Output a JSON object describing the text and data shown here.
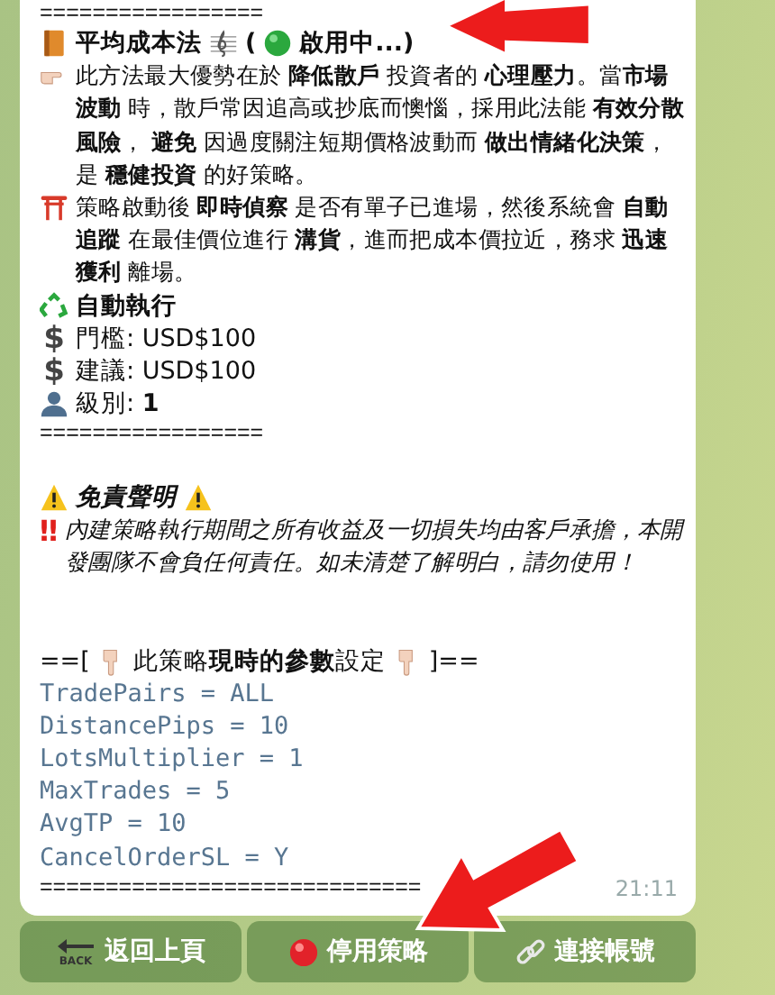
{
  "message": {
    "lines": [
      {
        "kind": "rule",
        "text": "================="
      },
      {
        "kind": "row",
        "segments": [
          {
            "kind": "book"
          },
          {
            "kind": "bold",
            "text": "平均成本法"
          },
          {
            "kind": "clef"
          },
          {
            "kind": "bold",
            "text": "("
          },
          {
            "kind": "status-dot"
          },
          {
            "kind": "bold",
            "text": "啟用中...)"
          }
        ]
      },
      {
        "kind": "para",
        "icon": {
          "kind": "hand-right"
        },
        "text": "此方法最大優勢在於 **降低散戶** 投資者的 **心理壓力**。當**市場波動** 時，散戶常因追高或抄底而懊惱，採用此法能 **有效分散風險**， **避免** 因過度關注短期價格波動而 **做出情緒化決策**，是 **穩健投資** 的好策略。"
      },
      {
        "kind": "para",
        "icon": {
          "kind": "torii"
        },
        "text": "策略啟動後 **即時偵察** 是否有單子已進場，然後系統會 **自動追蹤** 在最佳價位進行 **溝貨**，進而把成本價拉近，務求 **迅速獲利** 離場。"
      },
      {
        "kind": "row",
        "segments": [
          {
            "kind": "recycle"
          },
          {
            "kind": "bold",
            "text": "自動執行"
          }
        ]
      },
      {
        "kind": "row",
        "segments": [
          {
            "kind": "dollar",
            "text": "$"
          },
          {
            "kind": "plain",
            "text": "門檻: USD$100"
          }
        ]
      },
      {
        "kind": "row",
        "segments": [
          {
            "kind": "dollar",
            "text": "$"
          },
          {
            "kind": "plain",
            "text": "建議: USD$100"
          }
        ]
      },
      {
        "kind": "row",
        "segments": [
          {
            "kind": "person"
          },
          {
            "kind": "plain",
            "text": "級別: **1**"
          }
        ]
      },
      {
        "kind": "rule",
        "text": "================="
      },
      {
        "kind": "blank"
      },
      {
        "kind": "row",
        "segments": [
          {
            "kind": "warning"
          },
          {
            "kind": "bold-italic",
            "text": "免責聲明"
          },
          {
            "kind": "warning"
          }
        ]
      },
      {
        "kind": "note",
        "icon": {
          "kind": "exclaim",
          "text": "‼"
        },
        "text": "內建策略執行期間之所有收益及一切損失均由客戶承擔，本開發團隊不會負任何責任。如未清楚了解明白，請勿使用！"
      },
      {
        "kind": "blank"
      },
      {
        "kind": "blank"
      },
      {
        "kind": "row",
        "segments": [
          {
            "kind": "plain",
            "text": "==["
          },
          {
            "kind": "hand-down"
          },
          {
            "kind": "plain",
            "text": "此策略**現時的參數**設定"
          },
          {
            "kind": "hand-down"
          },
          {
            "kind": "plain",
            "text": "]=="
          }
        ]
      },
      {
        "kind": "code",
        "text": "TradePairs = ALL"
      },
      {
        "kind": "code",
        "text": "DistancePips = 10"
      },
      {
        "kind": "code",
        "text": "LotsMultiplier = 1"
      },
      {
        "kind": "code",
        "text": "MaxTrades = 5"
      },
      {
        "kind": "code",
        "text": "AvgTP = 10"
      },
      {
        "kind": "code",
        "text": "CancelOrderSL = Y"
      },
      {
        "kind": "rule",
        "text": "============================="
      }
    ],
    "time": "21:11"
  },
  "buttons": [
    {
      "kind": "back",
      "icon_text": "BACK",
      "label": "返回上頁"
    },
    {
      "kind": "stop",
      "label": "停用策略"
    },
    {
      "kind": "link",
      "label": "連接帳號"
    }
  ]
}
